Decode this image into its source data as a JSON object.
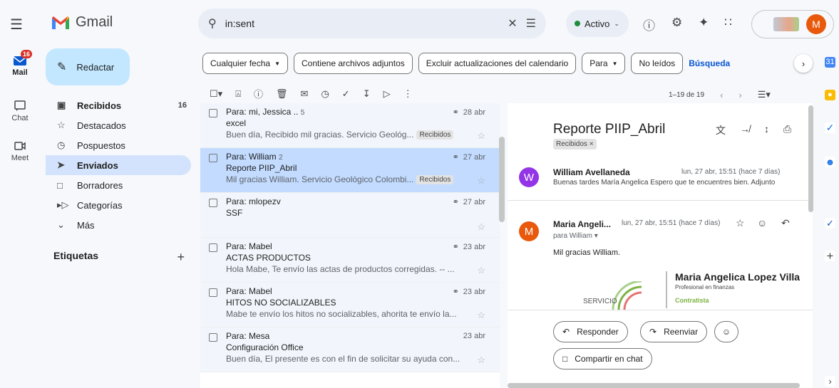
{
  "rail": {
    "mail_label": "Mail",
    "mail_badge": "16",
    "chat_label": "Chat",
    "meet_label": "Meet"
  },
  "header": {
    "app_name": "Gmail",
    "search_query": "in:sent",
    "status": "Activo"
  },
  "compose_label": "Redactar",
  "nav": [
    {
      "label": "Recibidos",
      "icon": "inbox-icon",
      "count": "16"
    },
    {
      "label": "Destacados",
      "icon": "star-icon",
      "count": ""
    },
    {
      "label": "Pospuestos",
      "icon": "clock-icon",
      "count": ""
    },
    {
      "label": "Enviados",
      "icon": "send-icon",
      "count": ""
    },
    {
      "label": "Borradores",
      "icon": "draft-icon",
      "count": ""
    },
    {
      "label": "Categorías",
      "icon": "label-icon",
      "count": ""
    },
    {
      "label": "Más",
      "icon": "chevron-down-icon",
      "count": ""
    }
  ],
  "labels_heading": "Etiquetas",
  "chips": {
    "date": "Cualquier fecha",
    "attachments": "Contiene archivos adjuntos",
    "exclude_calendar": "Excluir actualizaciones del calendario",
    "to": "Para",
    "unread": "No leídos",
    "advanced": "Búsqueda"
  },
  "pager": "1–19 de 19",
  "emails": [
    {
      "from": "Para: mi, Jessica ..",
      "count": "5",
      "date": "28 abr",
      "subject": "excel",
      "snippet": "Buen día, Recibido mil gracias. Servicio Geológ...",
      "tag": "Recibidos",
      "attach": true
    },
    {
      "from": "Para: William",
      "count": "2",
      "date": "27 abr",
      "subject": "Reporte PIIP_Abril",
      "snippet": "Mil gracias William. Servicio Geológico Colombi...",
      "tag": "Recibidos",
      "attach": true
    },
    {
      "from": "Para: mlopezv",
      "count": "",
      "date": "27 abr",
      "subject": "SSF",
      "snippet": "",
      "tag": "",
      "attach": true
    },
    {
      "from": "Para: Mabel",
      "count": "",
      "date": "23 abr",
      "subject": "ACTAS PRODUCTOS",
      "snippet": "Hola Mabe, Te envío las actas de productos corregidas. -- ...",
      "tag": "",
      "attach": true
    },
    {
      "from": "Para: Mabel",
      "count": "",
      "date": "23 abr",
      "subject": "HITOS NO SOCIALIZABLES",
      "snippet": "Mabe te envío los hitos no socializables, ahorita te envío la...",
      "tag": "",
      "attach": true
    },
    {
      "from": "Para: Mesa",
      "count": "",
      "date": "23 abr",
      "subject": "Configuración Office",
      "snippet": "Buen día, El presente es con el fin de solicitar su ayuda con...",
      "tag": "",
      "attach": false
    }
  ],
  "reading": {
    "title": "Reporte PIIP_Abril",
    "tag": "Recibidos ×",
    "msg1": {
      "initial": "W",
      "sender": "William Avellaneda",
      "date": "lun, 27 abr, 15:51 (hace 7 días)",
      "preview": "Buenas tardes María Angelica Espero que te encuentres bien. Adjunto"
    },
    "msg2": {
      "initial": "M",
      "sender": "Maria Angeli...",
      "date": "lun, 27 abr, 15:51 (hace 7 días)",
      "to": "para William",
      "body": "Mil gracias William."
    },
    "signature": {
      "name": "Maria Angelica Lopez Villa",
      "role": "Profesional en finanzas",
      "company": "Contratista",
      "logo_text": "SERVICIO"
    },
    "reply": "Responder",
    "forward": "Reenviar",
    "share_chat": "Compartir en chat"
  },
  "avatar_initial": "M",
  "colors": {
    "accent": "#0b57d0",
    "compose": "#c2e7ff",
    "selected_row": "#c2dbff",
    "active_nav": "#d3e3fd",
    "avatar": "#e8590c",
    "avatar_w": "#9334e6",
    "status_green": "#1e8e3e"
  }
}
